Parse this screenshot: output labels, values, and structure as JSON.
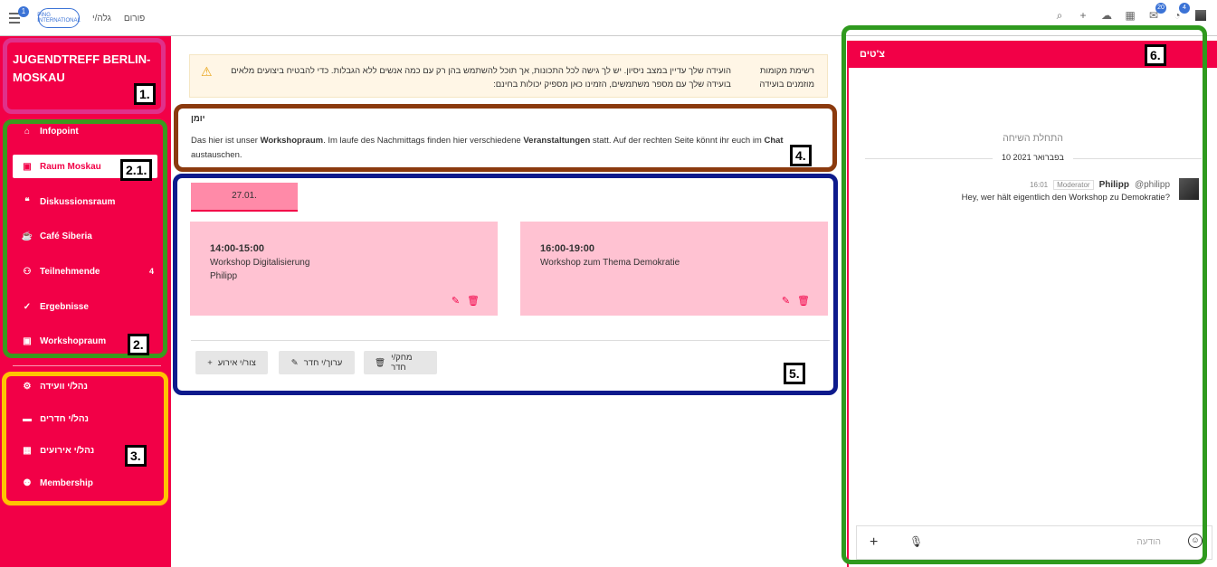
{
  "topbar": {
    "menu_badge": "1",
    "logo_text": "PING INTERNATIONAL",
    "links": [
      "גלה/י",
      "פורום"
    ],
    "badges": {
      "mail": "20",
      "bell": "4"
    }
  },
  "sidebar": {
    "brand": "JUGENDTREFF BERLIN-MOSKAU",
    "items": [
      {
        "label": "Infopoint",
        "icon": "home-icon",
        "active": false
      },
      {
        "label": "Raum Moskau",
        "icon": "room-icon",
        "active": true
      },
      {
        "label": "Diskussionsraum",
        "icon": "chat-icon",
        "active": false
      },
      {
        "label": "Café Siberia",
        "icon": "coffee-icon",
        "active": false
      },
      {
        "label": "Teilnehmende",
        "icon": "users-icon",
        "count": "4",
        "active": false
      },
      {
        "label": "Ergebnisse",
        "icon": "check-icon",
        "active": false
      },
      {
        "label": "Workshopraum",
        "icon": "room-icon",
        "active": false
      }
    ],
    "admin": [
      {
        "label": "נהל/י וועידה",
        "icon": "gear-icon"
      },
      {
        "label": "נהל/י חדרים",
        "icon": "desk-icon"
      },
      {
        "label": "נהל/י אירועים",
        "icon": "calendar-icon"
      },
      {
        "label": "Membership",
        "icon": "membership-icon"
      }
    ]
  },
  "warning": {
    "label": "רשימת מקומות מוזמנים בועידה",
    "text": "הועידה שלך עדיין במצב ניסיון. יש לך גישה לכל התכונות, אך תוכל להשתמש בהן רק עם כמה אנשים ללא הגבלות. כדי להבטיח ביצועים מלאים בועידה שלך עם מספר משתמשים, הזמינו כאן מספיק יכולות בחינם:"
  },
  "notes": {
    "title": "יומן",
    "t1": "Das hier ist unser ",
    "t2": "Workshopraum",
    "t3": ". Im laufe des Nachmittags finden hier verschiedene ",
    "t4": "Veranstaltungen",
    "t5": " statt. Auf der rechten Seite könnt ihr euch im ",
    "t6": "Chat",
    "t7": " austauschen."
  },
  "schedule": {
    "tab": "27.01.",
    "events": [
      {
        "time": "14:00-15:00",
        "title": "Workshop Digitalisierung",
        "host": "Philipp"
      },
      {
        "time": "16:00-19:00",
        "title": "Workshop zum Thema Demokratie",
        "host": ""
      }
    ],
    "buttons": {
      "create": "צור/י אירוע",
      "edit": "ערוך/י חדר",
      "delete": "מחק/י חדר"
    }
  },
  "chat": {
    "title": "צ'טים",
    "start": "התחלת השיחה",
    "date": "10 בפברואר 2021",
    "message": {
      "time": "16:01",
      "role": "Moderator",
      "name": "Philipp",
      "handle": "@philipp",
      "text": "Hey, wer hält eigentlich den Workshop zu Demokratie?"
    },
    "placeholder": "הודעה"
  },
  "annotations": [
    "1.",
    "2.1.",
    "2.",
    "3.",
    "4.",
    "5.",
    "6."
  ],
  "colors": {
    "accent": "#f20047",
    "event_bg": "#ffc2d2",
    "tab_bg": "#ff8aa8",
    "warning_bg": "#fff6e6"
  }
}
